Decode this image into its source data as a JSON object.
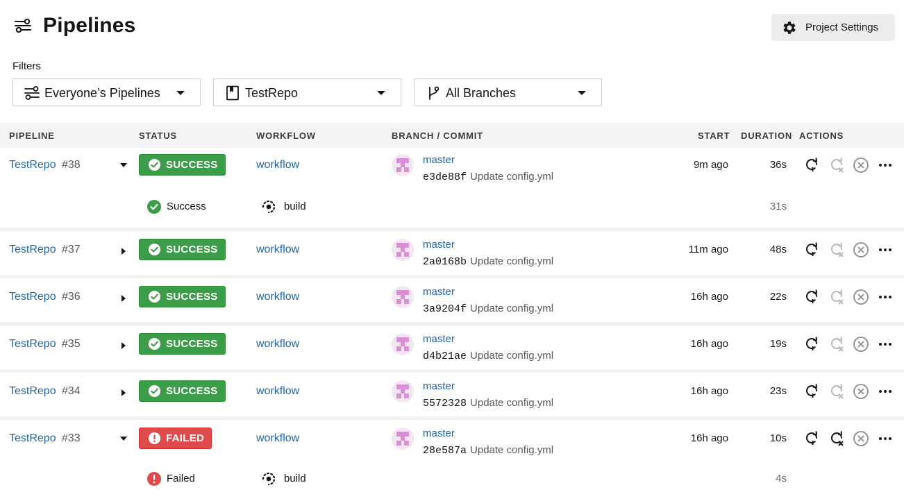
{
  "header": {
    "title": "Pipelines",
    "settings_label": "Project Settings"
  },
  "filters": {
    "label": "Filters",
    "pipelines": "Everyone’s Pipelines",
    "repo": "TestRepo",
    "branches": "All Branches"
  },
  "table": {
    "columns": [
      "PIPELINE",
      "STATUS",
      "WORKFLOW",
      "BRANCH / COMMIT",
      "START",
      "DURATION",
      "ACTIONS"
    ]
  },
  "rows": [
    {
      "repo": "TestRepo",
      "num": "#38",
      "expanded": true,
      "status": "SUCCESS",
      "status_type": "success",
      "workflow": "workflow",
      "branch": "master",
      "hash": "e3de88f",
      "message": "Update config.yml",
      "start": "9m ago",
      "duration": "36s",
      "job": {
        "status": "Success",
        "name": "build",
        "duration": "31s"
      }
    },
    {
      "repo": "TestRepo",
      "num": "#37",
      "expanded": false,
      "status": "SUCCESS",
      "status_type": "success",
      "workflow": "workflow",
      "branch": "master",
      "hash": "2a0168b",
      "message": "Update config.yml",
      "start": "11m ago",
      "duration": "48s"
    },
    {
      "repo": "TestRepo",
      "num": "#36",
      "expanded": false,
      "status": "SUCCESS",
      "status_type": "success",
      "workflow": "workflow",
      "branch": "master",
      "hash": "3a9204f",
      "message": "Update config.yml",
      "start": "16h ago",
      "duration": "22s"
    },
    {
      "repo": "TestRepo",
      "num": "#35",
      "expanded": false,
      "status": "SUCCESS",
      "status_type": "success",
      "workflow": "workflow",
      "branch": "master",
      "hash": "d4b21ae",
      "message": "Update config.yml",
      "start": "16h ago",
      "duration": "19s"
    },
    {
      "repo": "TestRepo",
      "num": "#34",
      "expanded": false,
      "status": "SUCCESS",
      "status_type": "success",
      "workflow": "workflow",
      "branch": "master",
      "hash": "5572328",
      "message": "Update config.yml",
      "start": "16h ago",
      "duration": "23s"
    },
    {
      "repo": "TestRepo",
      "num": "#33",
      "expanded": true,
      "status": "FAILED",
      "status_type": "failed",
      "workflow": "workflow",
      "branch": "master",
      "hash": "28e587a",
      "message": "Update config.yml",
      "start": "16h ago",
      "duration": "10s",
      "job": {
        "status": "Failed",
        "name": "build",
        "duration": "4s"
      }
    }
  ],
  "icons": {
    "title": "pipelines-icon",
    "settings": "gear-icon",
    "rerun": "rerun-icon",
    "rerun_failed": "rerun-failed-icon",
    "cancel": "cancel-icon",
    "more": "more-icon",
    "job": "job-icon"
  },
  "colors": {
    "link": "#2167a8",
    "success": "#3c9d48",
    "failed": "#e04a4a",
    "avatar": "#d98fd6",
    "header_bg": "#f4f4f4"
  }
}
